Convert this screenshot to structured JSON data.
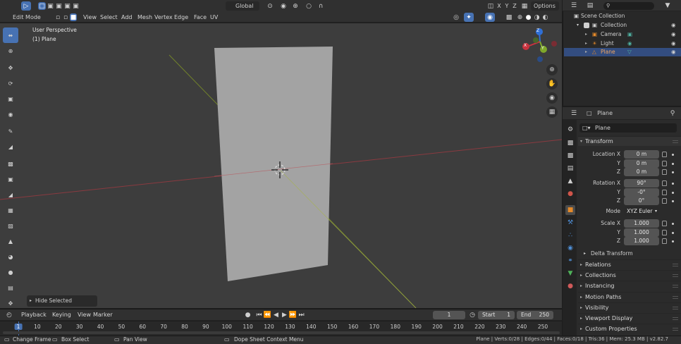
{
  "viewport": {
    "mode": "Edit Mode",
    "menus": [
      "View",
      "Select",
      "Add",
      "Mesh",
      "Vertex",
      "Edge",
      "Face",
      "UV"
    ],
    "orientation": "Global",
    "options_label": "Options",
    "axis_toggles": [
      "X",
      "Y",
      "Z"
    ],
    "overlay_title": "User Perspective",
    "overlay_object": "(1) Plane",
    "last_op": "Hide Selected",
    "gizmo_axes": [
      "X",
      "Y",
      "Z"
    ]
  },
  "outliner": {
    "scene_collection": "Scene Collection",
    "collection": "Collection",
    "items": [
      {
        "name": "Camera",
        "selected": false,
        "icon": "camera-icon"
      },
      {
        "name": "Light",
        "selected": false,
        "icon": "light-icon"
      },
      {
        "name": "Plane",
        "selected": true,
        "icon": "mesh-icon"
      }
    ]
  },
  "properties": {
    "object_name": "Plane",
    "name_field": "Plane",
    "transform_title": "Transform",
    "location_label": "Location X",
    "rotation_label": "Rotation X",
    "scale_label": "Scale X",
    "y_label": "Y",
    "z_label": "Z",
    "location": [
      "0 m",
      "0 m",
      "0 m"
    ],
    "rotation": [
      "90°",
      "-0°",
      "0°"
    ],
    "mode_label": "Mode",
    "mode_value": "XYZ Euler",
    "scale": [
      "1.000",
      "1.000",
      "1.000"
    ],
    "delta_transform": "Delta Transform",
    "panels": [
      "Relations",
      "Collections",
      "Instancing",
      "Motion Paths",
      "Visibility",
      "Viewport Display",
      "Custom Properties"
    ]
  },
  "timeline": {
    "menus": [
      "Playback",
      "Keying",
      "View",
      "Marker"
    ],
    "current_frame": "1",
    "start_label": "Start",
    "start_value": "1",
    "end_label": "End",
    "end_value": "250",
    "ticks": [
      "1",
      "10",
      "20",
      "30",
      "40",
      "50",
      "60",
      "70",
      "80",
      "90",
      "100",
      "110",
      "120",
      "130",
      "140",
      "150",
      "160",
      "170",
      "180",
      "190",
      "200",
      "210",
      "220",
      "230",
      "240",
      "250"
    ]
  },
  "statusbar": {
    "left_items": [
      "Change Frame",
      "Box Select",
      "Pan View",
      "Dope Sheet Context Menu"
    ],
    "stats": "Plane | Verts:0/28 | Edges:0/44 | Faces:0/18 | Tris:36 | Mem: 25.3 MB | v2.82.7"
  },
  "colors": {
    "accent": "#4772b3",
    "x_axis": "#c8333f",
    "y_axis": "#7fa82a",
    "z_axis": "#2f6fd6",
    "plane": "#a3a3a3"
  }
}
